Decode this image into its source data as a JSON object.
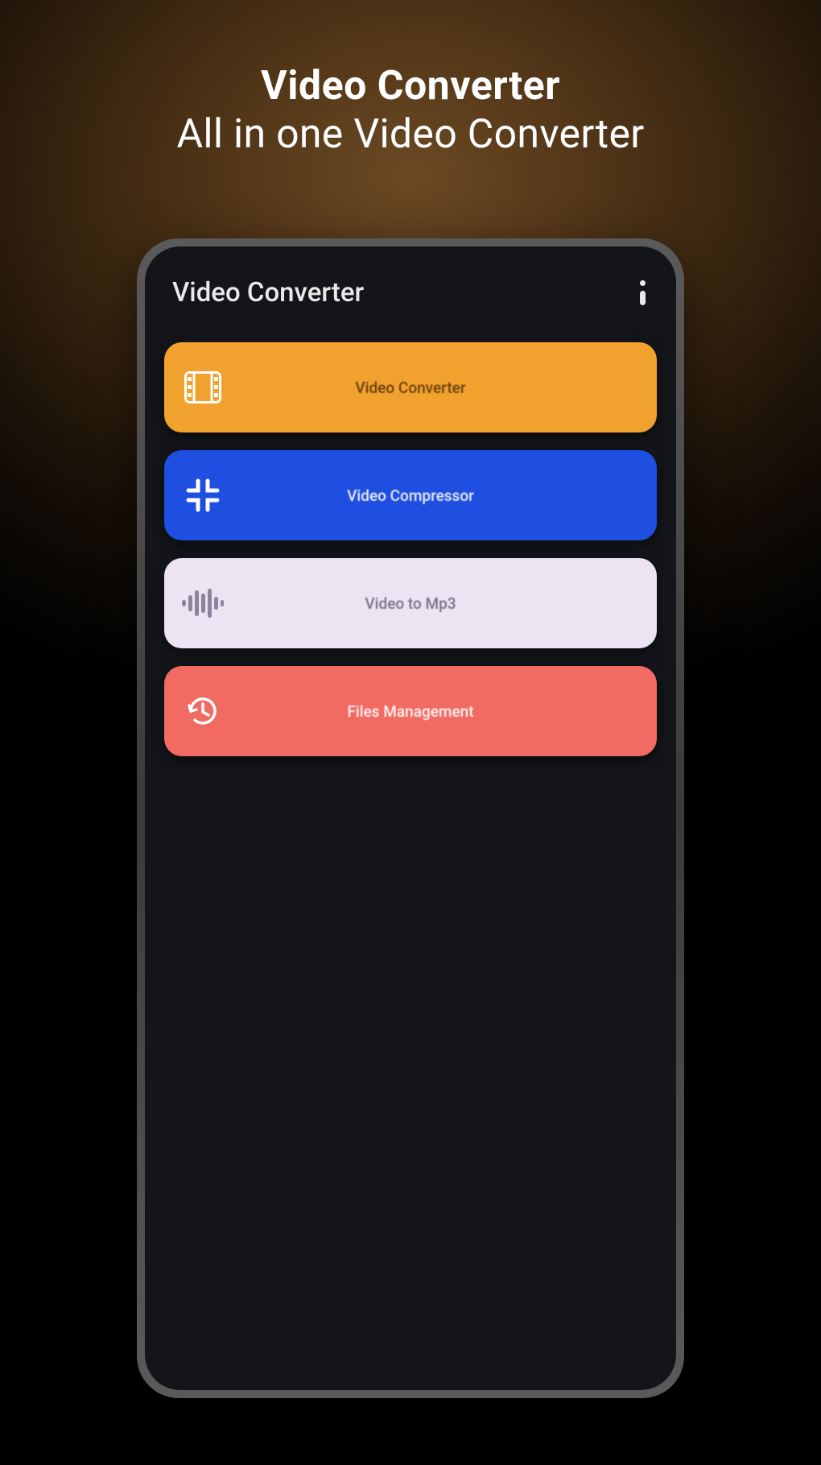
{
  "promo": {
    "title": "Video Converter",
    "subtitle": "All in one Video Converter"
  },
  "app": {
    "header_title": "Video Converter"
  },
  "menu": {
    "items": [
      {
        "label": "Video Converter",
        "icon": "film-icon",
        "color": "#f1a12d"
      },
      {
        "label": "Video Compressor",
        "icon": "compress-icon",
        "color": "#1e4fe0"
      },
      {
        "label": "Video to Mp3",
        "icon": "audio-wave-icon",
        "color": "#ece4f3"
      },
      {
        "label": "Files Management",
        "icon": "history-icon",
        "color": "#f26b63"
      }
    ]
  }
}
